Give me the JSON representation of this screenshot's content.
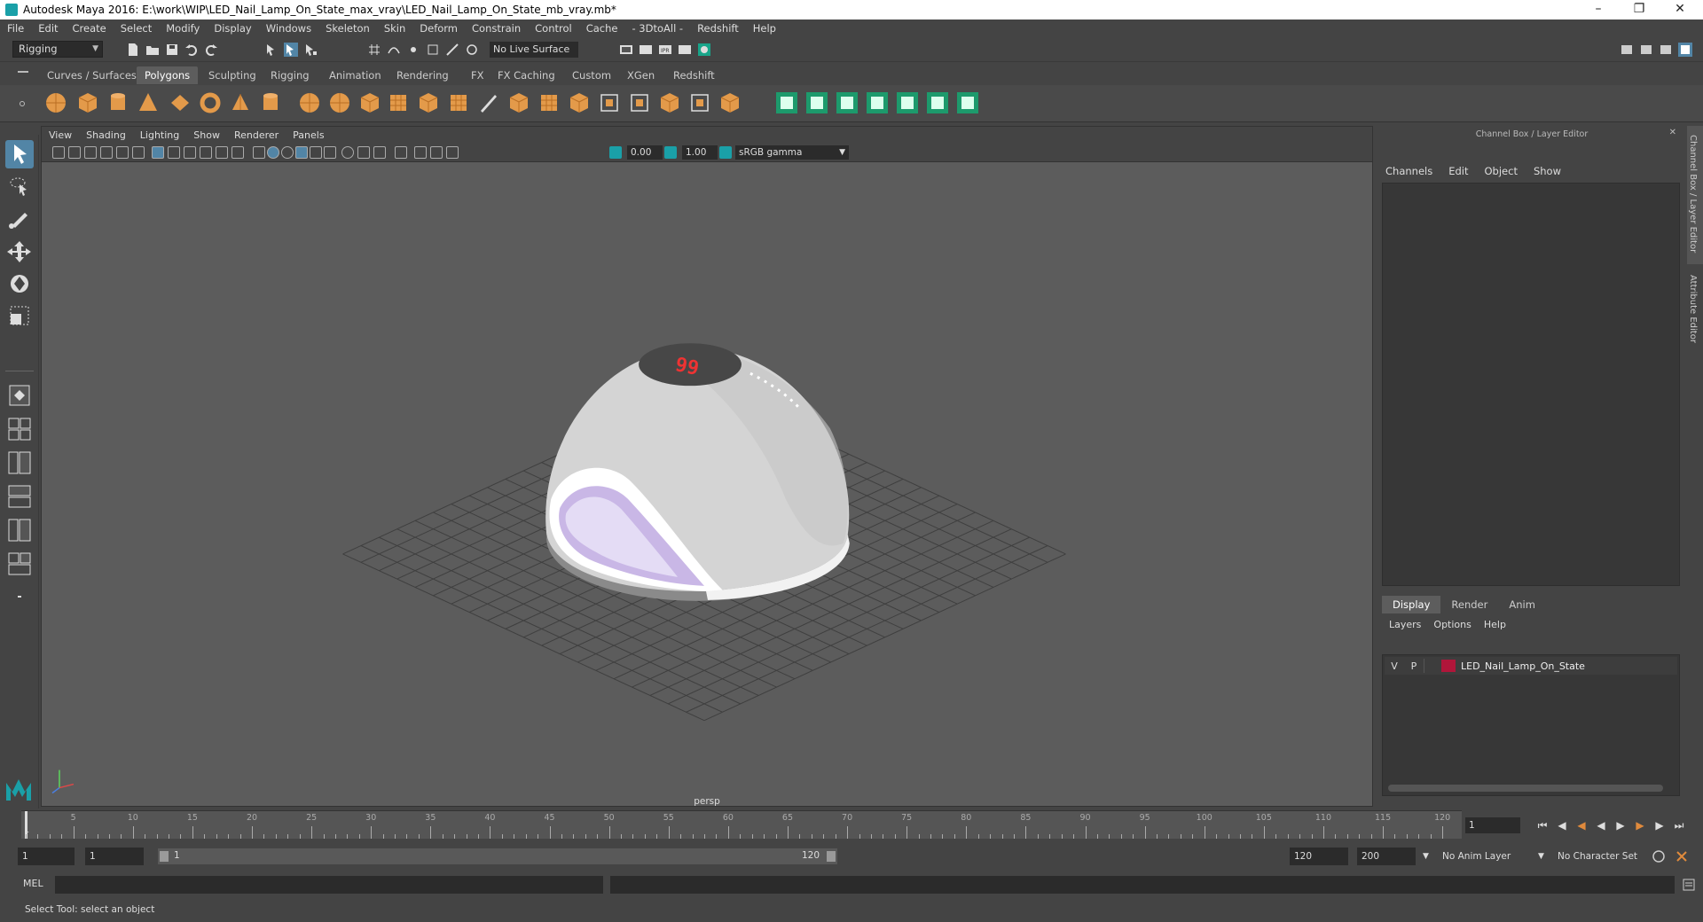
{
  "window": {
    "title": "Autodesk Maya 2016: E:\\work\\WIP\\LED_Nail_Lamp_On_State_max_vray\\LED_Nail_Lamp_On_State_mb_vray.mb*"
  },
  "menubar": [
    "File",
    "Edit",
    "Create",
    "Select",
    "Modify",
    "Display",
    "Windows",
    "Skeleton",
    "Skin",
    "Deform",
    "Constrain",
    "Control",
    "Cache",
    "- 3DtoAll -",
    "Redshift",
    "Help"
  ],
  "statusline": {
    "mode": "Rigging",
    "live_surface": "No Live Surface"
  },
  "shelf": {
    "tabs": [
      "Curves / Surfaces",
      "Polygons",
      "Sculpting",
      "Rigging",
      "Animation",
      "Rendering",
      "FX",
      "FX Caching",
      "Custom",
      "XGen",
      "Redshift"
    ],
    "active_tab": "Polygons"
  },
  "viewport": {
    "menu": [
      "View",
      "Shading",
      "Lighting",
      "Show",
      "Renderer",
      "Panels"
    ],
    "exposure": "0.00",
    "gamma": "1.00",
    "color_space": "sRGB gamma",
    "camera_label": "persp"
  },
  "channel_box": {
    "title": "Channel Box / Layer Editor",
    "menu": [
      "Channels",
      "Edit",
      "Object",
      "Show"
    ]
  },
  "layer_editor": {
    "tabs": [
      "Display",
      "Render",
      "Anim"
    ],
    "active_tab": "Display",
    "menu": [
      "Layers",
      "Options",
      "Help"
    ],
    "layers": [
      {
        "v": "V",
        "p": "P",
        "name": "LED_Nail_Lamp_On_State",
        "color": "#b0163a"
      }
    ]
  },
  "side_tabs": [
    "Channel Box / Layer Editor",
    "Attribute Editor"
  ],
  "timeline": {
    "ticks": [
      "5",
      "10",
      "15",
      "20",
      "25",
      "30",
      "35",
      "40",
      "45",
      "50",
      "55",
      "60",
      "65",
      "70",
      "75",
      "80",
      "85",
      "90",
      "95",
      "100",
      "105",
      "110",
      "115",
      "120"
    ],
    "first_label": "1",
    "current_frame": "1"
  },
  "range": {
    "start_time": "1",
    "playback_start": "1",
    "range_start_label": "1",
    "range_end_label": "120",
    "playback_end": "120",
    "end_time": "200",
    "anim_layer": "No Anim Layer",
    "character_set": "No Character Set"
  },
  "command_line": {
    "label": "MEL"
  },
  "help_line": {
    "text": "Select Tool: select an object"
  }
}
